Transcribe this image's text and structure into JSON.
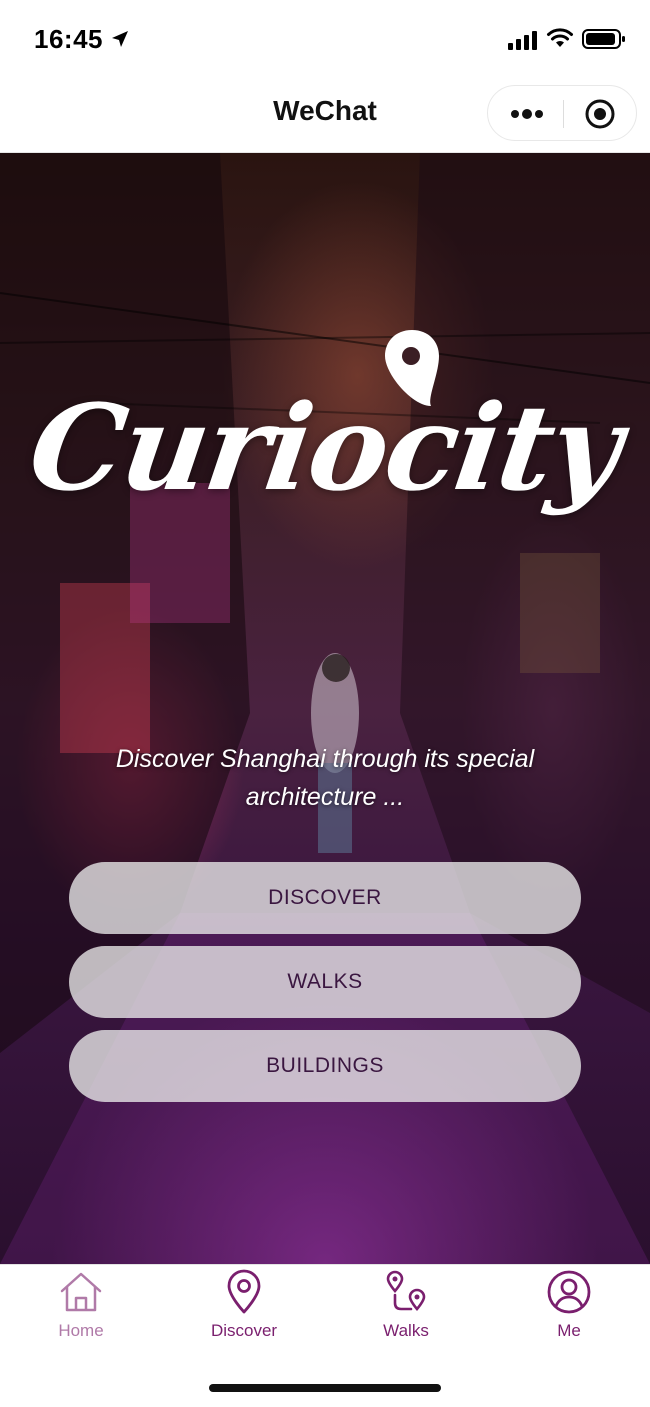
{
  "status_bar": {
    "time": "16:45",
    "icons": [
      "location-arrow-icon",
      "signal-icon",
      "wifi-icon",
      "battery-icon"
    ]
  },
  "nav": {
    "title": "WeChat",
    "icons": [
      "more-dots-icon",
      "target-icon"
    ]
  },
  "hero": {
    "brand": "Curiocity",
    "tagline": "Discover Shanghai through its special architecture ...",
    "buttons": [
      {
        "label": "DISCOVER"
      },
      {
        "label": "WALKS"
      },
      {
        "label": "BUILDINGS"
      }
    ]
  },
  "tab_bar": {
    "items": [
      {
        "label": "Home",
        "icon": "home-icon",
        "color": "#b07aa8"
      },
      {
        "label": "Discover",
        "icon": "map-pin-icon",
        "color": "#7a1f6e"
      },
      {
        "label": "Walks",
        "icon": "route-icon",
        "color": "#7a1f6e"
      },
      {
        "label": "Me",
        "icon": "user-icon",
        "color": "#7a1f6e"
      }
    ]
  },
  "colors": {
    "accent": "#7a1f6e",
    "accent_inactive": "#b07aa8",
    "button_text": "#3a1640"
  }
}
